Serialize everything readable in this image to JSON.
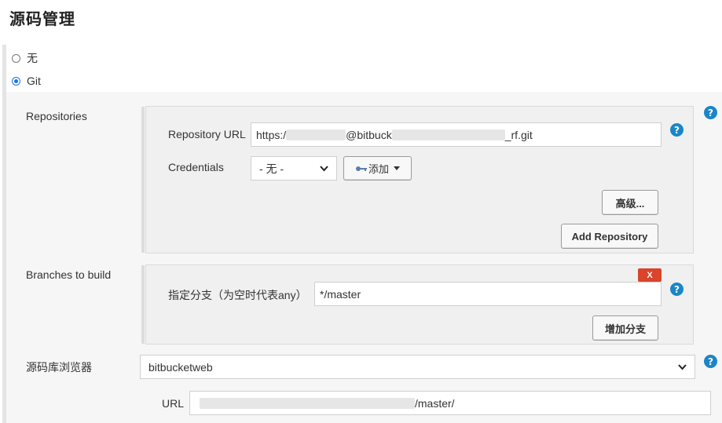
{
  "section": {
    "title": "源码管理"
  },
  "scm_options": [
    {
      "label": "无",
      "checked": false
    },
    {
      "label": "Git",
      "checked": true
    }
  ],
  "repositories": {
    "label": "Repositories",
    "url_label": "Repository URL",
    "url_prefix": "https:/",
    "url_middle": "@bitbuck",
    "url_suffix": "_rf.git",
    "credentials_label": "Credentials",
    "credentials_value": "- 无 -",
    "add_label": "添加",
    "advanced_label": "高级...",
    "add_repository_label": "Add Repository"
  },
  "branches": {
    "label": "Branches to build",
    "delete_label": "X",
    "specifier_label": "指定分支（为空时代表any）",
    "specifier_value": "*/master",
    "add_branch_label": "增加分支"
  },
  "browser": {
    "label": "源码库浏览器",
    "value": "bitbucketweb",
    "url_label": "URL",
    "url_suffix": "/master/"
  },
  "colors": {
    "help": "#1a86c8",
    "delete": "#d9442b",
    "radio_accent": "#1a73e8"
  },
  "icons": {
    "help": "question-mark",
    "add_key": "key",
    "dropdown": "chevron-down"
  }
}
